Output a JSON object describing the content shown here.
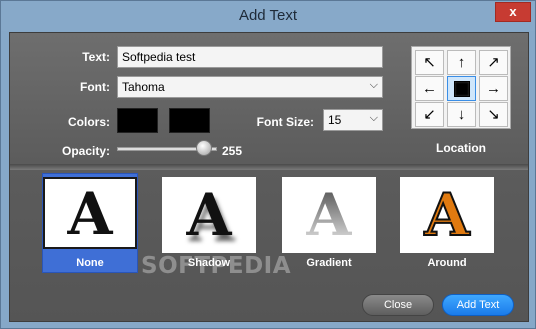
{
  "window": {
    "title": "Add Text",
    "close_glyph": "x"
  },
  "form": {
    "text_label": "Text:",
    "text_value": "Softpedia test",
    "font_label": "Font:",
    "font_value": "Tahoma",
    "colors_label": "Colors:",
    "font_size_label": "Font Size:",
    "font_size_value": "15",
    "opacity_label": "Opacity:",
    "opacity_value": "255",
    "opacity_fraction": 1.0,
    "color1": "#000000",
    "color2": "#000000"
  },
  "location": {
    "label": "Location",
    "cells": [
      "↖",
      "↑",
      "↗",
      "←",
      "",
      "→",
      "↙",
      "↓",
      "↘"
    ],
    "selected_index": 4
  },
  "styles": [
    {
      "label": "None",
      "glyph": "A",
      "selected": true
    },
    {
      "label": "Shadow",
      "glyph": "A",
      "selected": false
    },
    {
      "label": "Gradient",
      "glyph": "A",
      "selected": false
    },
    {
      "label": "Around",
      "glyph": "A",
      "selected": false
    }
  ],
  "watermark": "SOFTPEDIA",
  "buttons": {
    "close": "Close",
    "add": "Add Text"
  },
  "colors": {
    "accent": "#3f6fd6",
    "add_button": "#1a7bea",
    "around_fill": "#e07a10"
  }
}
